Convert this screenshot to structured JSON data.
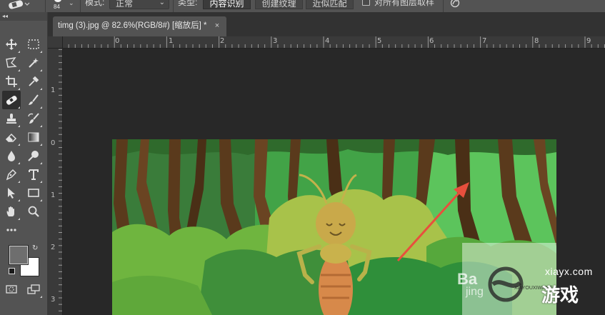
{
  "options_bar": {
    "brush_size": "84",
    "mode_label": "模式:",
    "mode_value": "正常",
    "type_label": "类型:",
    "type_buttons": [
      "内容识别",
      "创建纹理",
      "近似匹配"
    ],
    "sample_all_layers_label": "对所有图层取样",
    "sample_all_layers_checked": false
  },
  "tools": [
    "move-tool",
    "marquee-tool",
    "lasso-tool",
    "magic-wand-tool",
    "crop-tool",
    "eyedropper-tool",
    "spot-healing-brush-tool",
    "brush-tool",
    "clone-stamp-tool",
    "history-brush-tool",
    "eraser-tool",
    "gradient-tool",
    "blur-tool",
    "dodge-tool",
    "pen-tool",
    "type-tool",
    "path-selection-tool",
    "rectangle-tool",
    "hand-tool",
    "zoom-tool",
    "edit-toolbar"
  ],
  "colors": {
    "foreground": "#6e6e6e",
    "background": "#ffffff",
    "accent_arrow": "#e84f3d"
  },
  "document_tab": {
    "title": "timg (3).jpg @ 82.6%(RGB/8#) [缩放后] *",
    "close": "×"
  },
  "rulers": {
    "horizontal": [
      "0",
      "1",
      "2",
      "3",
      "4",
      "5",
      "6",
      "7",
      "8",
      "9"
    ],
    "vertical": [
      "1",
      "0",
      "1",
      "2",
      "3"
    ]
  },
  "watermark": {
    "site_text": "xiayx.com",
    "brand_text": "游戏",
    "small_text": "XIAYOUXIWANG",
    "baidu_fragment": "Ba",
    "jing_fragment": "jing"
  }
}
